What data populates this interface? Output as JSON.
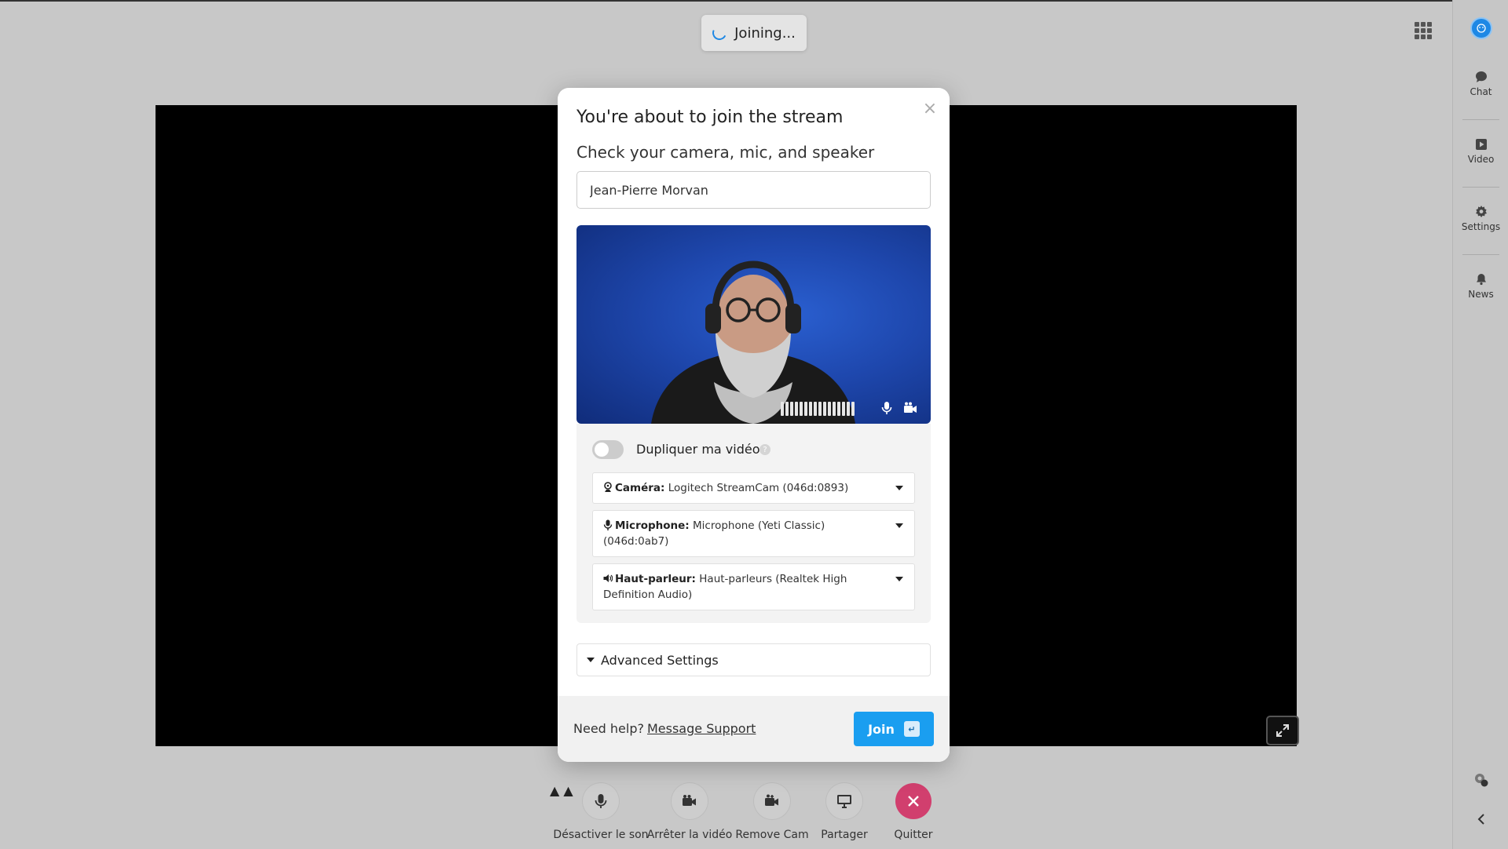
{
  "status": {
    "joining_label": "Joining..."
  },
  "sidebar": {
    "items": [
      {
        "label": "Chat",
        "icon": "chat-icon"
      },
      {
        "label": "Video",
        "icon": "video-icon"
      },
      {
        "label": "Settings",
        "icon": "gear-icon"
      },
      {
        "label": "News",
        "icon": "bell-icon"
      }
    ]
  },
  "modal": {
    "title": "You're about to join the stream",
    "subtitle": "Check your camera, mic, and speaker",
    "name_value": "Jean-Pierre Morvan",
    "duplicate_label": "Dupliquer ma vidéo",
    "duplicate_on": false,
    "camera": {
      "label": "Caméra:",
      "value": "Logitech StreamCam (046d:0893)"
    },
    "microphone": {
      "label": "Microphone:",
      "value": "Microphone (Yeti Classic) (046d:0ab7)"
    },
    "speaker": {
      "label": "Haut-parleur:",
      "value": "Haut-parleurs (Realtek High Definition Audio)"
    },
    "advanced_label": "Advanced Settings",
    "help_text": "Need help?",
    "support_link": "Message Support",
    "join_label": "Join",
    "join_key": "↵"
  },
  "controls": {
    "mute": "Désactiver le son",
    "stop_video": "Arrêter la vidéo",
    "remove_cam": "Remove Cam",
    "share": "Partager",
    "quit": "Quitter"
  },
  "colors": {
    "accent": "#1a9ef0",
    "quit": "#d13f6e",
    "stage": "#000000"
  }
}
